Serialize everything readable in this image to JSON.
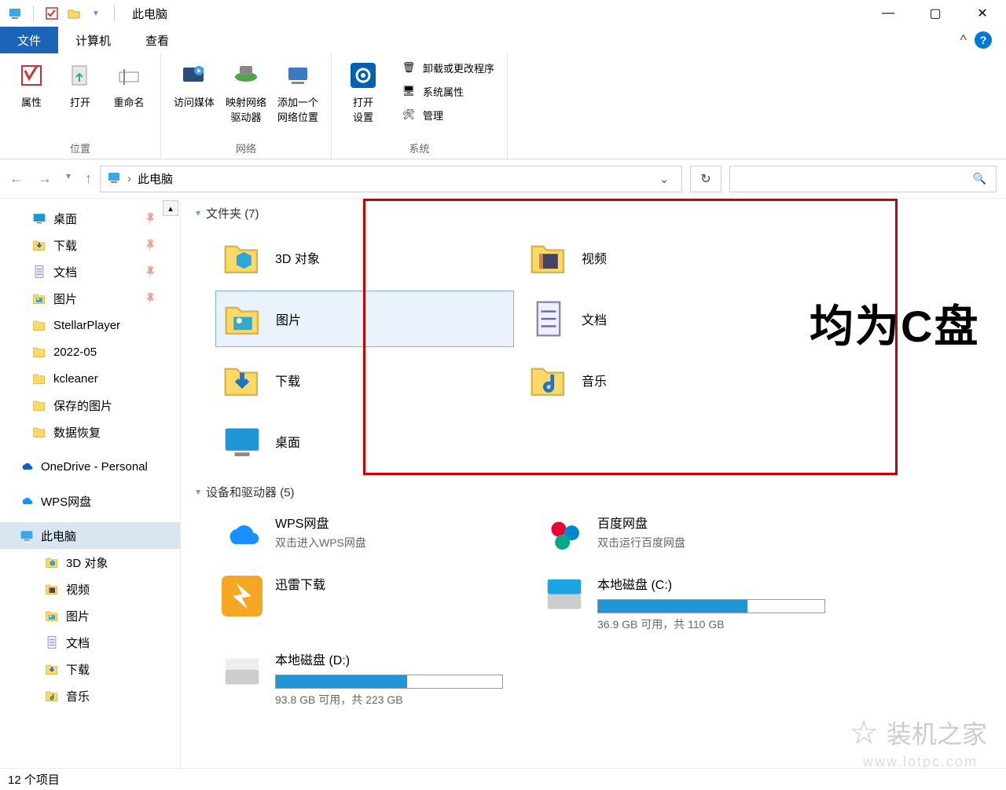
{
  "window": {
    "title": "此电脑"
  },
  "tabs": {
    "file": "文件",
    "computer": "计算机",
    "view": "查看"
  },
  "ribbon": {
    "location": {
      "properties": "属性",
      "open": "打开",
      "rename": "重命名",
      "group": "位置"
    },
    "network": {
      "media": "访问媒体",
      "map": "映射网络\n驱动器",
      "addloc": "添加一个\n网络位置",
      "group": "网络"
    },
    "system": {
      "settings": "打开\n设置",
      "uninstall": "卸载或更改程序",
      "sysprops": "系统属性",
      "manage": "管理",
      "group": "系统"
    }
  },
  "breadcrumb": {
    "loc": "此电脑"
  },
  "sidebar": {
    "items": [
      {
        "label": "桌面",
        "icon": "desktop",
        "pin": true
      },
      {
        "label": "下载",
        "icon": "download",
        "pin": true
      },
      {
        "label": "文档",
        "icon": "document",
        "pin": true
      },
      {
        "label": "图片",
        "icon": "picture",
        "pin": true
      },
      {
        "label": "StellarPlayer",
        "icon": "folder",
        "pin": false
      },
      {
        "label": "2022-05",
        "icon": "folder",
        "pin": false
      },
      {
        "label": "kcleaner",
        "icon": "folder",
        "pin": false
      },
      {
        "label": "保存的图片",
        "icon": "folder",
        "pin": false
      },
      {
        "label": "数据恢复",
        "icon": "folder",
        "pin": false
      },
      {
        "label": "OneDrive - Personal",
        "icon": "onedrive",
        "pin": false
      },
      {
        "label": "WPS网盘",
        "icon": "wps",
        "pin": false
      },
      {
        "label": "此电脑",
        "icon": "pc",
        "pin": false,
        "selected": true
      },
      {
        "label": "3D 对象",
        "icon": "3d",
        "pin": false
      },
      {
        "label": "视频",
        "icon": "video",
        "pin": false
      },
      {
        "label": "图片",
        "icon": "picture",
        "pin": false
      },
      {
        "label": "文档",
        "icon": "document",
        "pin": false
      },
      {
        "label": "下载",
        "icon": "download",
        "pin": false
      },
      {
        "label": "音乐",
        "icon": "music",
        "pin": false
      }
    ]
  },
  "content": {
    "group_folders": {
      "header": "文件夹 (7)"
    },
    "folders": [
      {
        "label": "3D 对象",
        "icon": "3d"
      },
      {
        "label": "视频",
        "icon": "video"
      },
      {
        "label": "图片",
        "icon": "picture",
        "selected": true
      },
      {
        "label": "文档",
        "icon": "document"
      },
      {
        "label": "下载",
        "icon": "download"
      },
      {
        "label": "音乐",
        "icon": "music"
      },
      {
        "label": "桌面",
        "icon": "desktop"
      }
    ],
    "group_devices": {
      "header": "设备和驱动器 (5)"
    },
    "devices": [
      {
        "title": "WPS网盘",
        "sub": "双击进入WPS网盘",
        "icon": "wps"
      },
      {
        "title": "百度网盘",
        "sub": "双击运行百度网盘",
        "icon": "baidu"
      },
      {
        "title": "迅雷下载",
        "sub": "",
        "icon": "xunlei"
      },
      {
        "title": "本地磁盘 (C:)",
        "sub": "36.9 GB 可用，共 110 GB",
        "icon": "disk-c",
        "used_pct": 66
      },
      {
        "title": "本地磁盘 (D:)",
        "sub": "93.8 GB 可用，共 223 GB",
        "icon": "disk-d",
        "used_pct": 58
      }
    ]
  },
  "annotation": "均为C盘",
  "watermark": {
    "text": "装机之家",
    "url": "www.lotpc.com"
  },
  "status": "12 个项目"
}
